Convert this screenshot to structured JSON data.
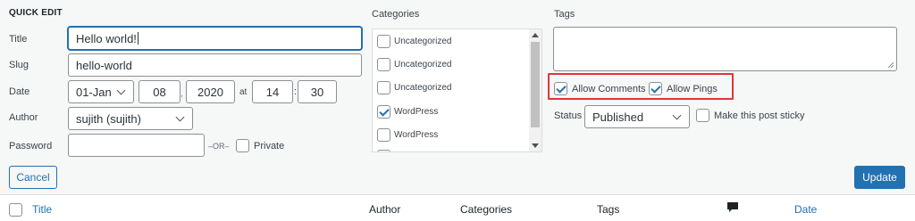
{
  "panel": {
    "title": "QUICK EDIT"
  },
  "fields": {
    "title_label": "Title",
    "title_value": "Hello world!",
    "slug_label": "Slug",
    "slug_value": "hello-world",
    "date_label": "Date",
    "month": "01-Jan",
    "day": "08",
    "year": "2020",
    "at": "at",
    "hour": "14",
    "minute": "30",
    "author_label": "Author",
    "author_value": "sujith (sujith)",
    "password_label": "Password",
    "password_value": "",
    "or_text": "–OR–",
    "private_label": "Private"
  },
  "categories": {
    "heading": "Categories",
    "items": [
      {
        "label": "Uncategorized",
        "checked": false
      },
      {
        "label": "Uncategorized",
        "checked": false
      },
      {
        "label": "Uncategorized",
        "checked": false
      },
      {
        "label": "WordPress",
        "checked": true
      },
      {
        "label": "WordPress",
        "checked": false
      }
    ]
  },
  "tags": {
    "heading": "Tags",
    "value": ""
  },
  "options": {
    "allow_comments": "Allow Comments",
    "allow_comments_checked": true,
    "allow_pings": "Allow Pings",
    "allow_pings_checked": true,
    "status_label": "Status",
    "status_value": "Published",
    "sticky_label": "Make this post sticky",
    "sticky_checked": false
  },
  "actions": {
    "cancel": "Cancel",
    "update": "Update"
  },
  "table_header": {
    "title": "Title",
    "author": "Author",
    "categories": "Categories",
    "tags": "Tags",
    "comments_icon": "comment-bubble-icon",
    "date": "Date"
  },
  "colors": {
    "accent": "#2271b1",
    "highlight": "#e4333a"
  }
}
